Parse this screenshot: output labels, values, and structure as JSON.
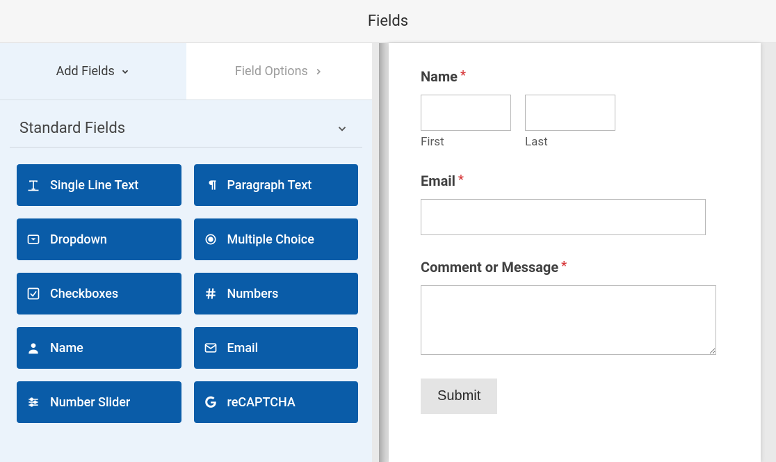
{
  "header": {
    "title": "Fields"
  },
  "tabs": {
    "add_fields": "Add Fields",
    "field_options": "Field Options"
  },
  "section": {
    "standard_fields": "Standard Fields"
  },
  "fields": {
    "single_line_text": "Single Line Text",
    "paragraph_text": "Paragraph Text",
    "dropdown": "Dropdown",
    "multiple_choice": "Multiple Choice",
    "checkboxes": "Checkboxes",
    "numbers": "Numbers",
    "name": "Name",
    "email": "Email",
    "number_slider": "Number Slider",
    "recaptcha": "reCAPTCHA"
  },
  "preview": {
    "name_label": "Name",
    "first_sublabel": "First",
    "last_sublabel": "Last",
    "email_label": "Email",
    "message_label": "Comment or Message",
    "submit_label": "Submit",
    "required_mark": "*"
  }
}
